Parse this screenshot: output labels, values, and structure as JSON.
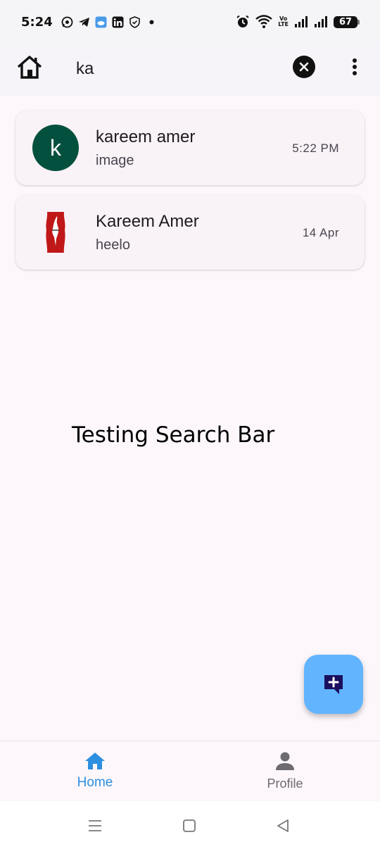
{
  "status_bar": {
    "time": "5:24",
    "network_label_top": "Vo",
    "network_label_bottom": "LTE",
    "battery": "67"
  },
  "app_bar": {
    "search_value": "ka"
  },
  "chats": [
    {
      "name": "kareem amer",
      "message": "image",
      "time": "5:22 PM",
      "avatar_letter": "k"
    },
    {
      "name": "Kareem Amer",
      "message": "heelo",
      "time": "14 Apr"
    }
  ],
  "center_label": "Testing Search Bar",
  "bottom_nav": {
    "home_label": "Home",
    "profile_label": "Profile"
  },
  "colors": {
    "accent": "#2d8fe0",
    "fab": "#62b4ff",
    "avatar": "#04503f",
    "background": "#fdf7fb"
  }
}
